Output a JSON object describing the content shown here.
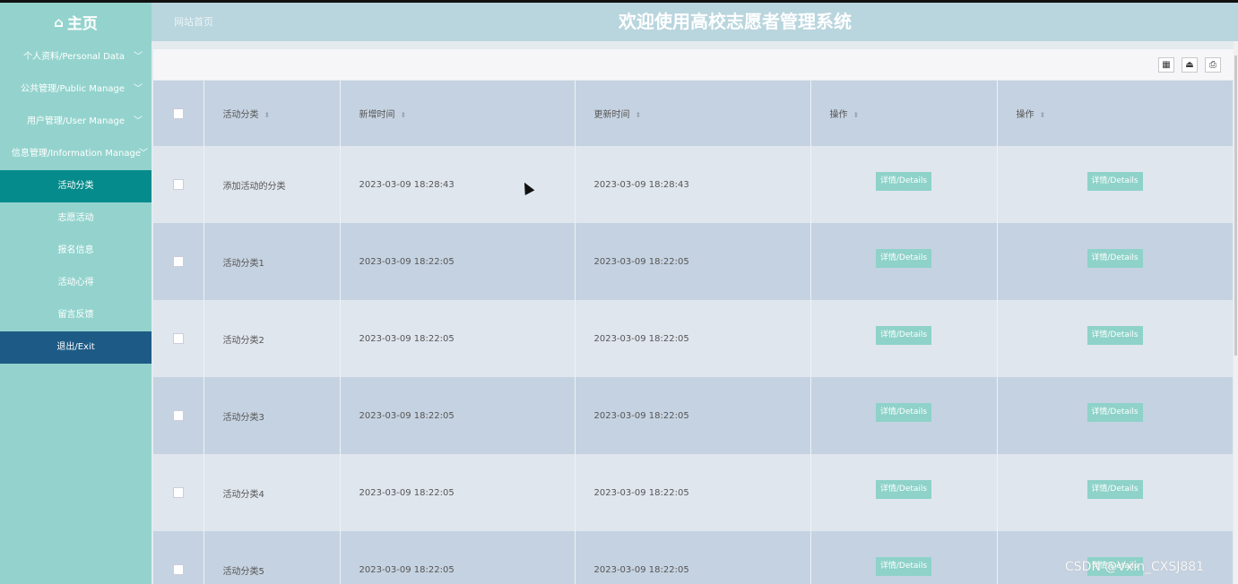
{
  "header": {
    "home_label": "主页",
    "site_home": "网站首页",
    "title": "欢迎使用高校志愿者管理系统"
  },
  "sidebar": {
    "items": [
      {
        "label": "个人资料/Personal Data",
        "expandable": true
      },
      {
        "label": "公共管理/Public Manage",
        "expandable": true
      },
      {
        "label": "用户管理/User Manage",
        "expandable": true
      },
      {
        "label": "信息管理/Information Manage",
        "expandable": true
      },
      {
        "label": "活动分类",
        "active": true
      },
      {
        "label": "志愿活动"
      },
      {
        "label": "报名信息"
      },
      {
        "label": "活动心得"
      },
      {
        "label": "留言反馈"
      },
      {
        "label": "退出/Exit"
      }
    ]
  },
  "toolbar": {
    "icons": [
      "columns-icon",
      "export-icon",
      "print-icon"
    ]
  },
  "table": {
    "headers": [
      "活动分类",
      "新增时间",
      "更新时间",
      "操作",
      "操作"
    ],
    "rows": [
      {
        "category": "添加活动的分类",
        "created": "2023-03-09 18:28:43",
        "updated": "2023-03-09 18:28:43"
      },
      {
        "category": "活动分类1",
        "created": "2023-03-09 18:22:05",
        "updated": "2023-03-09 18:22:05"
      },
      {
        "category": "活动分类2",
        "created": "2023-03-09 18:22:05",
        "updated": "2023-03-09 18:22:05"
      },
      {
        "category": "活动分类3",
        "created": "2023-03-09 18:22:05",
        "updated": "2023-03-09 18:22:05"
      },
      {
        "category": "活动分类4",
        "created": "2023-03-09 18:22:05",
        "updated": "2023-03-09 18:22:05"
      },
      {
        "category": "活动分类5",
        "created": "2023-03-09 18:22:05",
        "updated": "2023-03-09 18:22:05"
      }
    ],
    "detail_label": "详情/Details"
  },
  "watermark": "CSDN @Vxin_CXSJ881",
  "colors": {
    "header_bg": "#b9d5de",
    "sidebar_bg": "#94d3cd",
    "active_item": "#068b8c",
    "exit_item": "#1d5b86",
    "detail_button": "#8ed2c9"
  }
}
